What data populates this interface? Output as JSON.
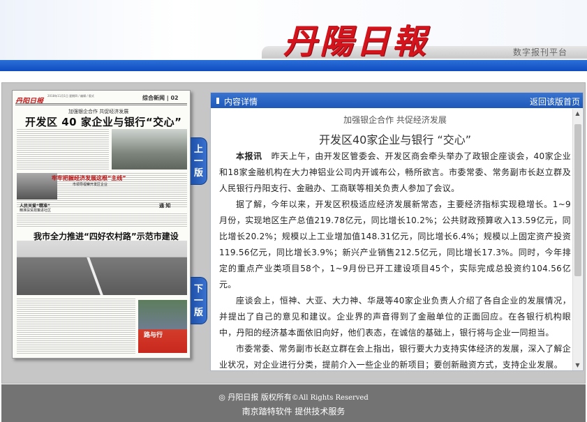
{
  "header": {
    "logo_text": "丹陽日報",
    "platform_label": "数字报刊平台"
  },
  "paper_thumb": {
    "masthead": "丹阳日报",
    "masthead_info": "2018年11月1日 星期四 / 编辑 / 版式",
    "section": "综合新闻 | 02",
    "subheadline": "加强银企合作 共促经济发展",
    "headline": "开发区 40 家企业与银行“交心”",
    "headline2": "牢牢把握经济发展这根“主线”",
    "headline2_sub": "市领导视察开发区企业",
    "side_heading": "人民关爱“精准”",
    "side_heading_sub": "精准扶贫政策进社区",
    "notice": "通 知",
    "big_headline": "我市全力推进“四好农村路”示范市建设",
    "ad_text": "路与行"
  },
  "tabs": {
    "up_label": [
      "上",
      "一",
      "版"
    ],
    "down_label": [
      "下",
      "一",
      "版"
    ]
  },
  "content_panel": {
    "bar_title": "内容详情",
    "back_link": "返回该版首页",
    "kicker": "加强银企合作 共促经济发展",
    "title": "开发区40家企业与银行 “交心”",
    "lead": "本报讯",
    "paragraphs": [
      "昨天上午，由开发区管委会、开发区商会牵头举办了政银企座谈会，40家企业和18家金融机构在大力神铝业公司内开诚布公，畅所欲言。市委常委、常务副市长赵立群及人民银行丹阳支行、金融办、工商联等相关负责人参加了会议。",
      "据了解，今年以来，开发区积极适应经济发展新常态，主要经济指标实现稳增长。1~9月份，实现地区生产总值219.78亿元，同比增长10.2%；公共财政预算收入13.59亿元，同比增长20.2%；规模以上工业增加值148.31亿元，同比增长6.4%；规模以上固定资产投资119.56亿元，同比增长3.9%；新兴产业销售212.5亿元，同比增长17.3%。同时，今年排定的重点产业类项目58个，1~9月份已开工建设项目45个，实际完成总投资约104.56亿元。",
      "座谈会上，恒神、大亚、大力神、华晟等40家企业负责人介绍了各自企业的发展情况，并提出了自己的意见和建议。企业界的声音得到了金融单位的正面回应。在各银行机构眼中，丹阳的经济基本面依旧向好，他们表态，在诚信的基础上，银行将与企业一同担当。",
      "市委常委、常务副市长赵立群在会上指出，银行要大力支持实体经济的发展，深入了解企业状况，对企业进行分类，提前介入一些企业的新项目；要创新融资方式，支持企业发展。"
    ]
  },
  "footer": {
    "copyright_prefix": "◎ 丹阳日报 版权所有",
    "copyright_suffix": "©All Rights Reserved",
    "support": "南京踏特软件 提供技术服务"
  },
  "colors": {
    "brand_red": "#d4141c",
    "bar_blue": "#1e58b8",
    "footer_grey": "#737373"
  }
}
